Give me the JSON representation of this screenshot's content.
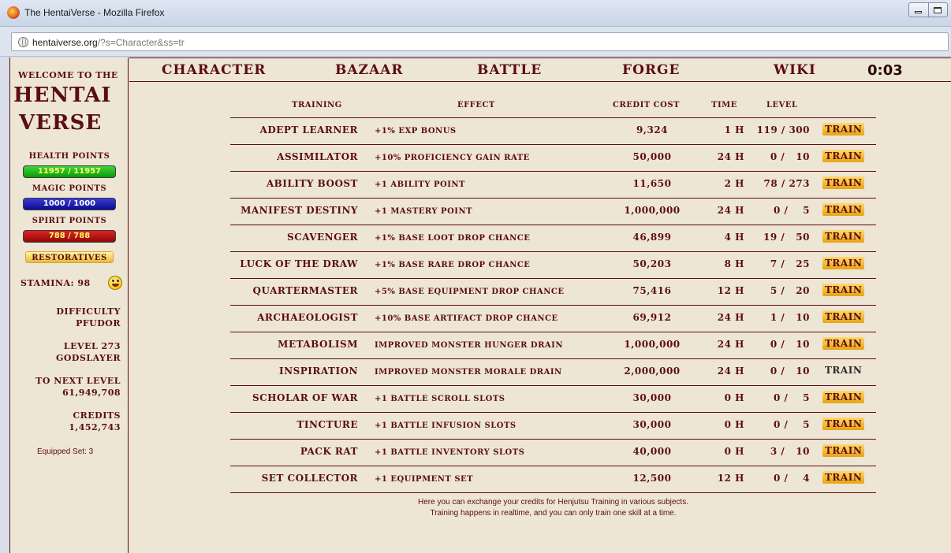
{
  "window": {
    "title": "The HentaiVerse - Mozilla Firefox"
  },
  "browser": {
    "url_host": "hentaiverse.org",
    "url_path": "/?s=Character&ss=tr"
  },
  "sidebar": {
    "welcome": "Welcome to the",
    "logo_line1": "Hentai",
    "logo_line2": "Verse",
    "health_label": "Health points",
    "health_value": "11957 / 11957",
    "magic_label": "Magic points",
    "magic_value": "1000 / 1000",
    "spirit_label": "Spirit points",
    "spirit_value": "788 / 788",
    "restoratives": "Restoratives",
    "stamina": "Stamina: 98",
    "difficulty_label": "Difficulty",
    "difficulty_value": "PFUDOR",
    "level_label": "Level 273",
    "level_title": "Godslayer",
    "next_label": "To next level",
    "next_value": "61,949,708",
    "credits_label": "Credits",
    "credits_value": "1,452,743",
    "equipped_set": "Equipped Set: 3"
  },
  "nav": {
    "character": "Character",
    "bazaar": "Bazaar",
    "battle": "Battle",
    "forge": "Forge",
    "wiki": "Wiki",
    "timer": "0:03"
  },
  "table": {
    "headers": {
      "training": "Training",
      "effect": "Effect",
      "cost": "Credit Cost",
      "time": "Time",
      "level": "Level"
    },
    "rows": [
      {
        "name": "Adept Learner",
        "effect": "+1% EXP Bonus",
        "cost": "9,324",
        "time": "1 H",
        "level": "119 / 300",
        "action": "TRAIN",
        "enabled": true
      },
      {
        "name": "Assimilator",
        "effect": "+10% Proficiency Gain Rate",
        "cost": "50,000",
        "time": "24 H",
        "level": "0 /   10",
        "action": "TRAIN",
        "enabled": true
      },
      {
        "name": "Ability Boost",
        "effect": "+1 Ability Point",
        "cost": "11,650",
        "time": "2 H",
        "level": "78 / 273",
        "action": "TRAIN",
        "enabled": true
      },
      {
        "name": "Manifest Destiny",
        "effect": "+1 Mastery Point",
        "cost": "1,000,000",
        "time": "24 H",
        "level": "0 /    5",
        "action": "TRAIN",
        "enabled": true
      },
      {
        "name": "Scavenger",
        "effect": "+1% Base Loot Drop Chance",
        "cost": "46,899",
        "time": "4 H",
        "level": "19 /   50",
        "action": "TRAIN",
        "enabled": true
      },
      {
        "name": "Luck of the Draw",
        "effect": "+1% Base Rare Drop Chance",
        "cost": "50,203",
        "time": "8 H",
        "level": "7 /   25",
        "action": "TRAIN",
        "enabled": true
      },
      {
        "name": "Quartermaster",
        "effect": "+5% Base Equipment Drop Chance",
        "cost": "75,416",
        "time": "12 H",
        "level": "5 /   20",
        "action": "TRAIN",
        "enabled": true
      },
      {
        "name": "Archaeologist",
        "effect": "+10% Base Artifact Drop Chance",
        "cost": "69,912",
        "time": "24 H",
        "level": "1 /   10",
        "action": "TRAIN",
        "enabled": true
      },
      {
        "name": "Metabolism",
        "effect": "Improved Monster Hunger Drain",
        "cost": "1,000,000",
        "time": "24 H",
        "level": "0 /   10",
        "action": "TRAIN",
        "enabled": true
      },
      {
        "name": "Inspiration",
        "effect": "Improved Monster Morale Drain",
        "cost": "2,000,000",
        "time": "24 H",
        "level": "0 /   10",
        "action": "TRAIN",
        "enabled": false
      },
      {
        "name": "Scholar of War",
        "effect": "+1 Battle Scroll Slots",
        "cost": "30,000",
        "time": "0 H",
        "level": "0 /    5",
        "action": "TRAIN",
        "enabled": true
      },
      {
        "name": "Tincture",
        "effect": "+1 Battle Infusion Slots",
        "cost": "30,000",
        "time": "0 H",
        "level": "0 /    5",
        "action": "TRAIN",
        "enabled": true
      },
      {
        "name": "Pack Rat",
        "effect": "+1 Battle Inventory Slots",
        "cost": "40,000",
        "time": "0 H",
        "level": "3 /   10",
        "action": "TRAIN",
        "enabled": true
      },
      {
        "name": "Set Collector",
        "effect": "+1 Equipment Set",
        "cost": "12,500",
        "time": "12 H",
        "level": "0 /    4",
        "action": "TRAIN",
        "enabled": true
      }
    ]
  },
  "footer": {
    "line1": "Here you can exchange your credits for Henjutsu Training in various subjects.",
    "line2": "Training happens in realtime, and you can only train one skill at a time."
  },
  "colors": {
    "text": "#5c0d11",
    "background": "#ede6d4",
    "train_button": "#e8a313",
    "health": "#0a9a0a",
    "magic": "#0c0c8c",
    "spirit": "#8c0a0a"
  }
}
